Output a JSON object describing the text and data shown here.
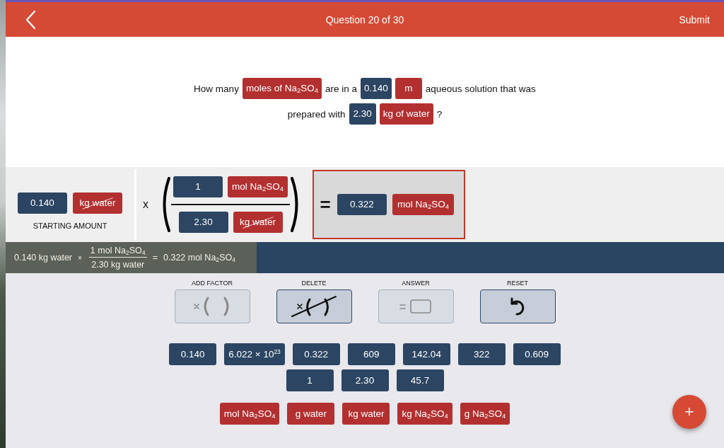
{
  "header": {
    "title": "Question 20 of 30",
    "submit": "Submit"
  },
  "question": {
    "lines": [
      {
        "segments": [
          {
            "kind": "text",
            "text": "How many"
          },
          {
            "kind": "unit",
            "text": "moles of Na$_{2}$SO$_{4}$"
          },
          {
            "kind": "text",
            "text": "are in a"
          },
          {
            "kind": "number",
            "text": "0.140"
          },
          {
            "kind": "unit",
            "text": "m"
          },
          {
            "kind": "text",
            "text": "aqueous solution that was"
          }
        ]
      },
      {
        "segments": [
          {
            "kind": "text",
            "text": "prepared with"
          },
          {
            "kind": "number",
            "text": "2.30"
          },
          {
            "kind": "unit",
            "text": "kg of water"
          },
          {
            "kind": "text",
            "text": "?"
          }
        ]
      }
    ]
  },
  "setup": {
    "starting_amount": {
      "value": "0.140",
      "unit": "kg water",
      "unit_cancelled": true,
      "label": "STARTING AMOUNT"
    },
    "operator": "x",
    "factor": {
      "numerator": {
        "value": "1",
        "unit": "mol Na$_{2}$SO$_{4}$",
        "unit_cancelled": false
      },
      "denominator": {
        "value": "2.30",
        "unit": "kg water",
        "unit_cancelled": true
      }
    },
    "answer": {
      "equals": "=",
      "value": "0.322",
      "unit": "mol Na$_{2}$SO$_{4}$"
    }
  },
  "summary": {
    "start": "0.140 kg water",
    "operator": "×",
    "numerator": "1 mol Na$_{2}$SO$_{4}$",
    "denominator": "2.30 kg water",
    "equals": "=",
    "result": "0.322 mol Na$_{2}$SO$_{4}$"
  },
  "tools": [
    {
      "kind": "add_factor",
      "label": "ADD FACTOR",
      "disabled": true
    },
    {
      "kind": "delete",
      "label": "DELETE",
      "disabled": false
    },
    {
      "kind": "answer",
      "label": "ANSWER",
      "disabled": true
    },
    {
      "kind": "reset",
      "label": "RESET",
      "disabled": false
    }
  ],
  "number_tiles": [
    {
      "tiles": [
        "0.140",
        "6.022 × 10$^{23}$",
        "0.322",
        "609",
        "142.04",
        "322",
        "0.609"
      ]
    },
    {
      "tiles": [
        "1",
        "2.30",
        "45.7"
      ]
    }
  ],
  "unit_tiles": [
    "mol Na$_{2}$SO$_{4}$",
    "g water",
    "kg water",
    "kg Na$_{2}$SO$_{4}$",
    "g Na$_{2}$SO$_{4}$"
  ],
  "fab": "+"
}
